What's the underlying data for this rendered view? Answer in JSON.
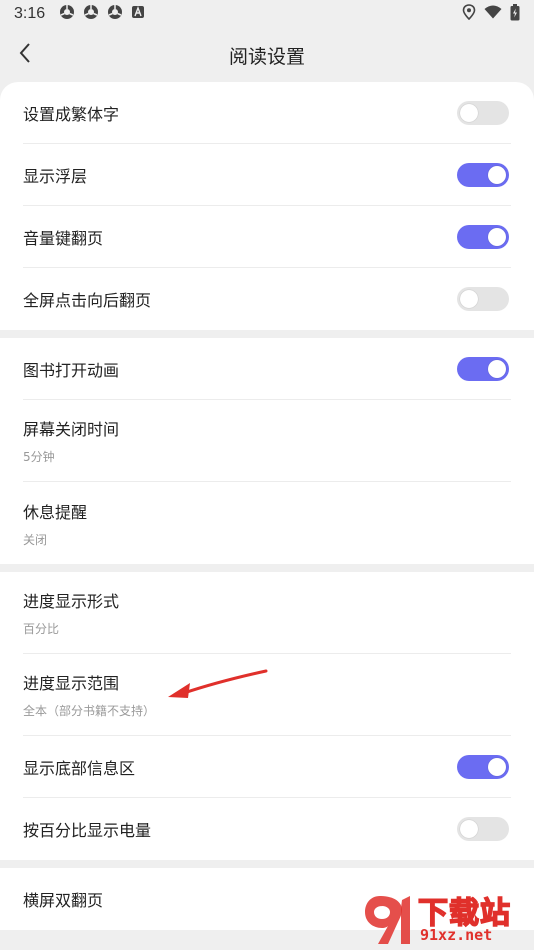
{
  "status_bar": {
    "time": "3:16",
    "left_icons": [
      "chromium-icon",
      "chromium-icon",
      "chromium-icon",
      "a-badge-icon"
    ],
    "right_icons": [
      "location-icon",
      "wifi-icon",
      "battery-charging-icon"
    ]
  },
  "header": {
    "title": "阅读设置",
    "back_icon": "chevron-left-icon"
  },
  "groups": [
    {
      "rows": [
        {
          "label": "设置成繁体字",
          "toggle": false
        },
        {
          "label": "显示浮层",
          "toggle": true
        },
        {
          "label": "音量键翻页",
          "toggle": true
        },
        {
          "label": "全屏点击向后翻页",
          "toggle": false
        }
      ]
    },
    {
      "rows": [
        {
          "label": "图书打开动画",
          "toggle": true
        },
        {
          "label": "屏幕关闭时间",
          "sub": "5分钟"
        },
        {
          "label": "休息提醒",
          "sub": "关闭"
        }
      ]
    },
    {
      "rows": [
        {
          "label": "进度显示形式",
          "sub": "百分比"
        },
        {
          "label": "进度显示范围",
          "sub": "全本（部分书籍不支持）"
        },
        {
          "label": "显示底部信息区",
          "toggle": true
        },
        {
          "label": "按百分比显示电量",
          "toggle": false
        }
      ]
    },
    {
      "rows": [
        {
          "label": "横屏双翻页"
        }
      ]
    }
  ],
  "watermark": {
    "line1": "下载站",
    "line2": "91xz.net"
  },
  "colors": {
    "accent": "#6b6cf2",
    "toggle_off": "#e4e4e4",
    "background": "#efefef",
    "arrow": "#e0302b"
  }
}
